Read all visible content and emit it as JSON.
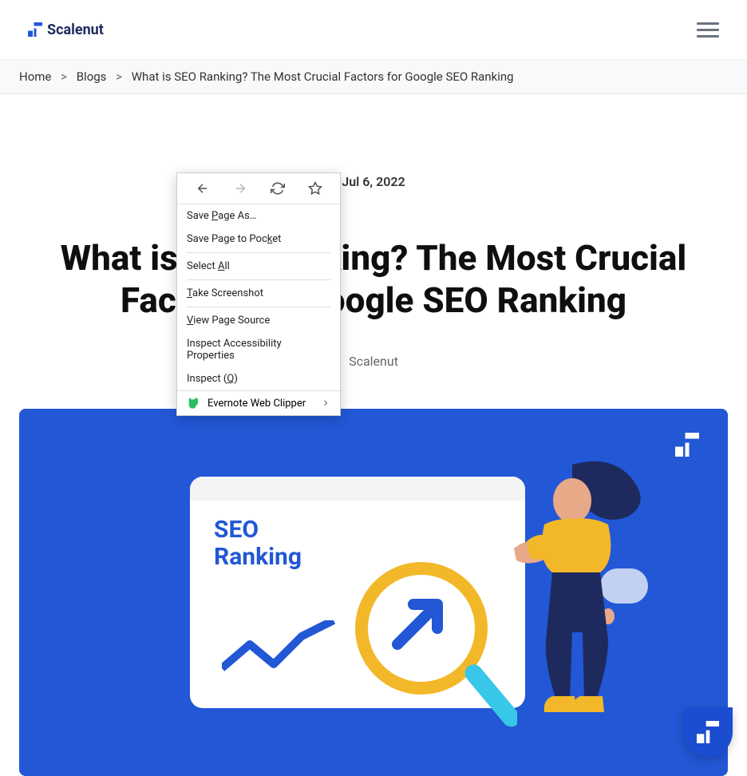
{
  "header": {
    "brand": "Scalenut"
  },
  "breadcrumb": {
    "home": "Home",
    "blogs": "Blogs",
    "sep": ">",
    "current": "What is SEO Ranking? The Most Crucial Factors for Google SEO Ranking"
  },
  "article": {
    "date": "Jul 6, 2022",
    "title": "What is SEO Ranking? The Most Crucial Factors for Google SEO Ranking",
    "author": "Scalenut",
    "hero_text_1": "SEO",
    "hero_text_2": "Ranking"
  },
  "context_menu": {
    "save_as": "Save Page As…",
    "save_pocket": "Save Page to Pocket",
    "select_all": "Select All",
    "screenshot": "Take Screenshot",
    "view_source": "View Page Source",
    "inspect_a11y": "Inspect Accessibility Properties",
    "inspect": "Inspect (Q)",
    "evernote": "Evernote Web Clipper",
    "hotkey_p": "P",
    "hotkey_k": "k",
    "hotkey_a": "A",
    "hotkey_t": "T",
    "hotkey_v": "V",
    "hotkey_q": "Q"
  }
}
